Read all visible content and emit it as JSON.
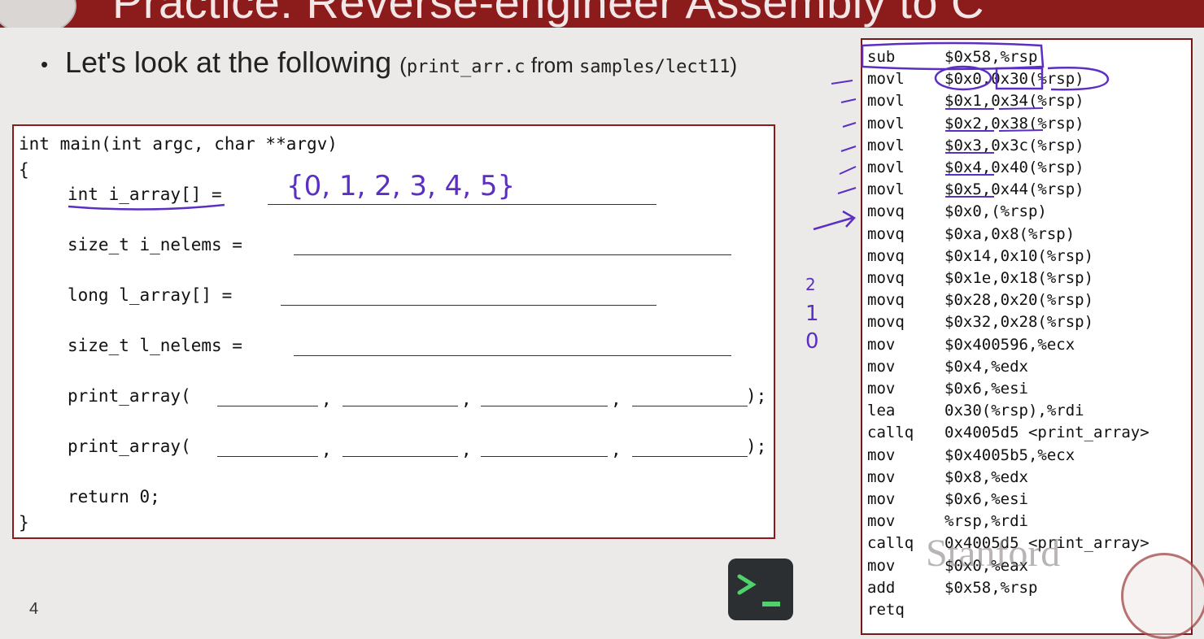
{
  "slide": {
    "title": "Practice: Reverse-engineer Assembly to C",
    "bullet_bullet": "•",
    "bullet_text": "Let's look at the following",
    "bullet_paren_open": "(",
    "bullet_file": "print_arr.c",
    "bullet_from": " from ",
    "bullet_dir": "samples/lect11",
    "bullet_paren_close": ")",
    "page_number": "4"
  },
  "code": {
    "line1": "int main(int argc, char **argv)",
    "line2": "{",
    "line3": "int i_array[] =",
    "line4": "size_t i_nelems =",
    "line5": "long l_array[] =",
    "line6": "size_t l_nelems =",
    "line7": "print_array(",
    "line8": "print_array(",
    "line9": "return 0;",
    "line10": "}",
    "comma": ",",
    "close": ");"
  },
  "annotations": {
    "array_values": "{0, 1, 2, 3, 4, 5}",
    "count_2": "2",
    "count_1": "1",
    "count_0": "0"
  },
  "assembly": [
    {
      "op": "sub",
      "args": "$0x58,%rsp"
    },
    {
      "op": "movl",
      "args": "$0x0,0x30(%rsp)"
    },
    {
      "op": "movl",
      "args": "$0x1,0x34(%rsp)"
    },
    {
      "op": "movl",
      "args": "$0x2,0x38(%rsp)"
    },
    {
      "op": "movl",
      "args": "$0x3,0x3c(%rsp)"
    },
    {
      "op": "movl",
      "args": "$0x4,0x40(%rsp)"
    },
    {
      "op": "movl",
      "args": "$0x5,0x44(%rsp)"
    },
    {
      "op": "movq",
      "args": "$0x0,(%rsp)"
    },
    {
      "op": "movq",
      "args": "$0xa,0x8(%rsp)"
    },
    {
      "op": "movq",
      "args": "$0x14,0x10(%rsp)"
    },
    {
      "op": "movq",
      "args": "$0x1e,0x18(%rsp)"
    },
    {
      "op": "movq",
      "args": "$0x28,0x20(%rsp)"
    },
    {
      "op": "movq",
      "args": "$0x32,0x28(%rsp)"
    },
    {
      "op": "mov",
      "args": "$0x400596,%ecx"
    },
    {
      "op": "mov",
      "args": "$0x4,%edx"
    },
    {
      "op": "mov",
      "args": "$0x6,%esi"
    },
    {
      "op": "lea",
      "args": "0x30(%rsp),%rdi"
    },
    {
      "op": "callq",
      "args": "0x4005d5 <print_array>"
    },
    {
      "op": "mov",
      "args": "$0x4005b5,%ecx"
    },
    {
      "op": "mov",
      "args": "$0x8,%edx"
    },
    {
      "op": "mov",
      "args": "$0x6,%esi"
    },
    {
      "op": "mov",
      "args": "%rsp,%rdi"
    },
    {
      "op": "callq",
      "args": "0x4005d5 <print_array>"
    },
    {
      "op": "mov",
      "args": "$0x0,%eax"
    },
    {
      "op": "add",
      "args": "$0x58,%rsp"
    },
    {
      "op": "retq",
      "args": ""
    }
  ],
  "watermark": {
    "text": "Stanford"
  },
  "colors": {
    "title_bar": "#8c1c1c",
    "ink": "#5a2fc2",
    "code_border": "#8c1c1c"
  },
  "icons": {
    "terminal": "terminal-icon",
    "logo": "stanford-seal-icon"
  }
}
